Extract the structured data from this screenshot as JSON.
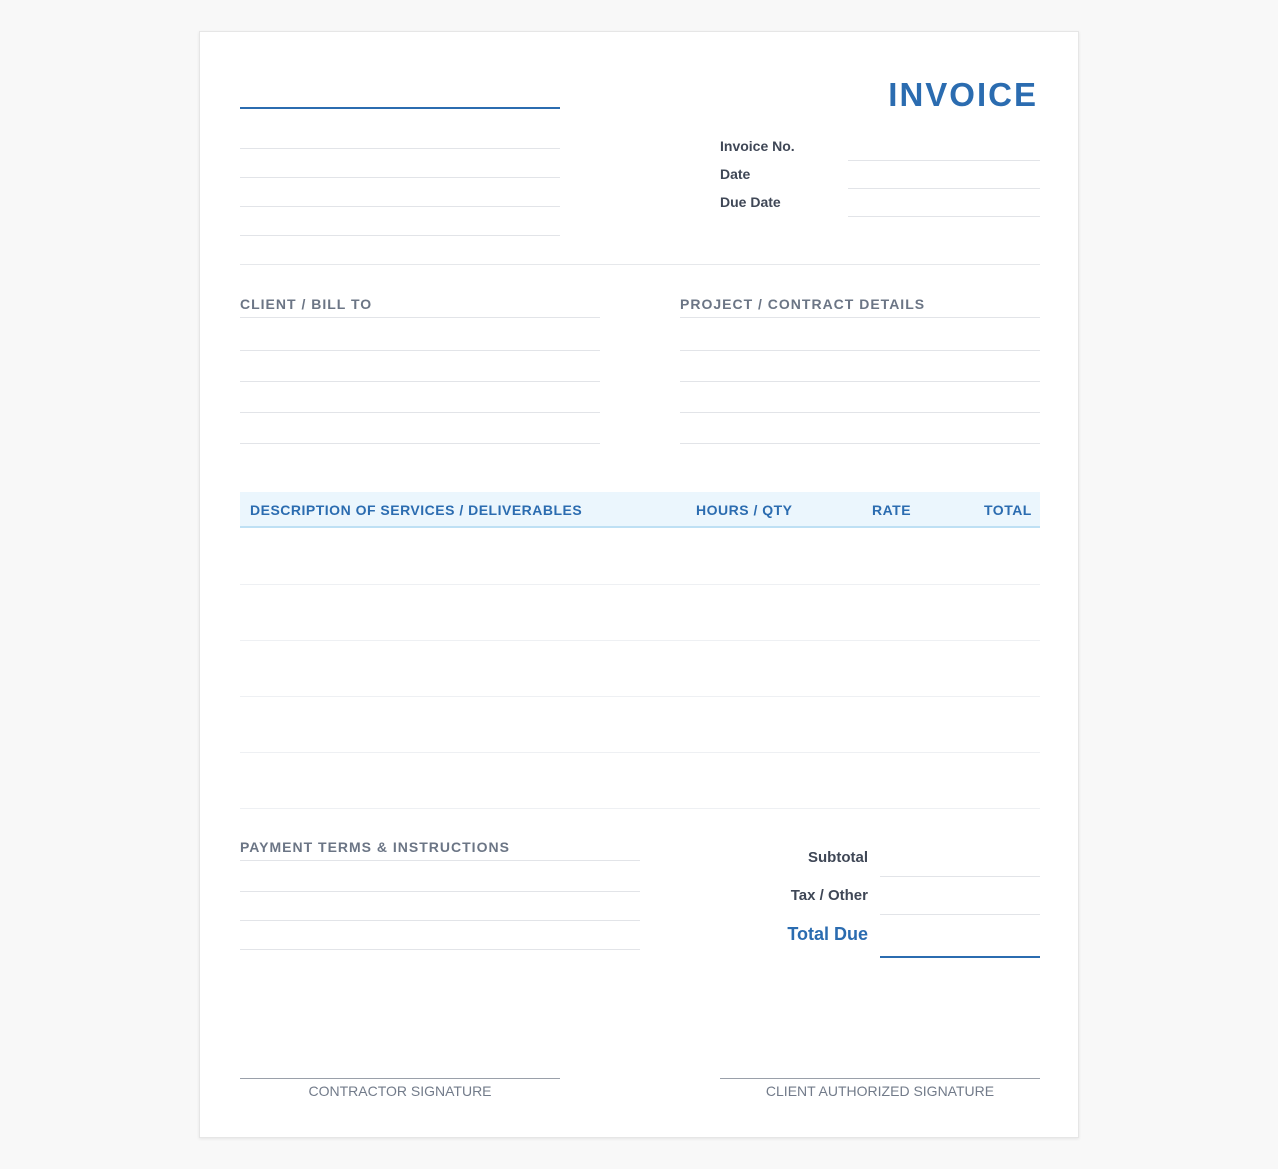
{
  "document": {
    "title": "INVOICE",
    "meta": {
      "invoice_no_label": "Invoice No.",
      "date_label": "Date",
      "due_date_label": "Due Date"
    },
    "sections": {
      "client_label": "CLIENT / BILL TO",
      "project_label": "PROJECT / CONTRACT DETAILS"
    },
    "table": {
      "columns": [
        "DESCRIPTION OF SERVICES / DELIVERABLES",
        "HOURS / QTY",
        "RATE",
        "TOTAL"
      ]
    },
    "payment": {
      "label": "PAYMENT TERMS & INSTRUCTIONS"
    },
    "totals": {
      "subtotal_label": "Subtotal",
      "tax_label": "Tax / Other",
      "total_due_label": "Total Due"
    },
    "signatures": {
      "contractor_label": "CONTRACTOR SIGNATURE",
      "client_label": "CLIENT AUTHORIZED SIGNATURE"
    },
    "colors": {
      "accent": "#2b6cb0",
      "header_bg": "#ebf6fd",
      "muted_text": "#6b7585",
      "rule": "#e2e4e8"
    }
  }
}
